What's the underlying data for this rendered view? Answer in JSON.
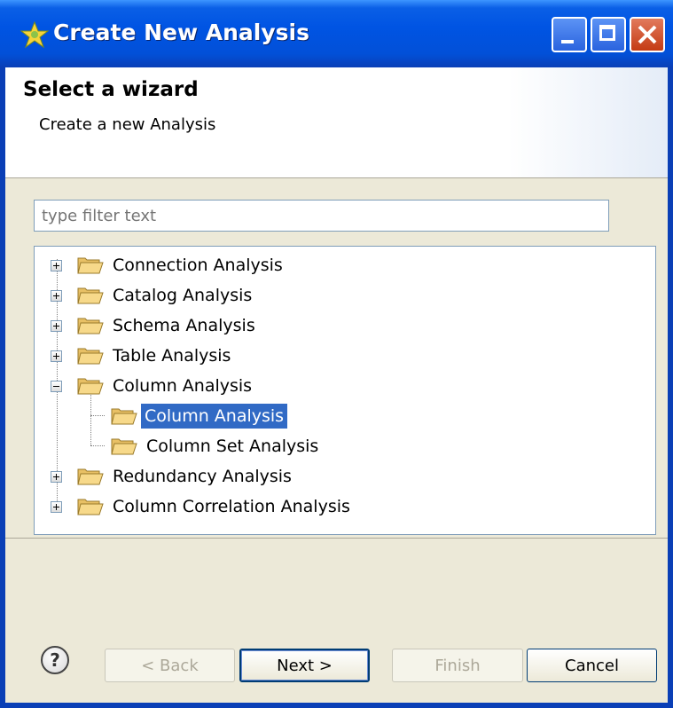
{
  "window": {
    "title": "Create New Analysis",
    "icon": "star-icon"
  },
  "header": {
    "title": "Select a wizard",
    "subtitle": "Create a new Analysis"
  },
  "filter": {
    "placeholder": "type filter text",
    "value": ""
  },
  "tree": {
    "items": [
      {
        "label": "Connection Analysis",
        "expanded": false
      },
      {
        "label": "Catalog Analysis",
        "expanded": false
      },
      {
        "label": "Schema Analysis",
        "expanded": false
      },
      {
        "label": "Table Analysis",
        "expanded": false
      },
      {
        "label": "Column Analysis",
        "expanded": true,
        "children": [
          {
            "label": "Column Analysis",
            "selected": true
          },
          {
            "label": "Column Set Analysis",
            "selected": false
          }
        ]
      },
      {
        "label": "Redundancy Analysis",
        "expanded": false
      },
      {
        "label": "Column Correlation Analysis",
        "expanded": false
      }
    ]
  },
  "buttons": {
    "help": "?",
    "back": "< Back",
    "next": "Next >",
    "finish": "Finish",
    "cancel": "Cancel"
  },
  "colors": {
    "titlebar": "#0054e3",
    "selection": "#316ac5",
    "dialog_bg": "#ece9d8"
  }
}
